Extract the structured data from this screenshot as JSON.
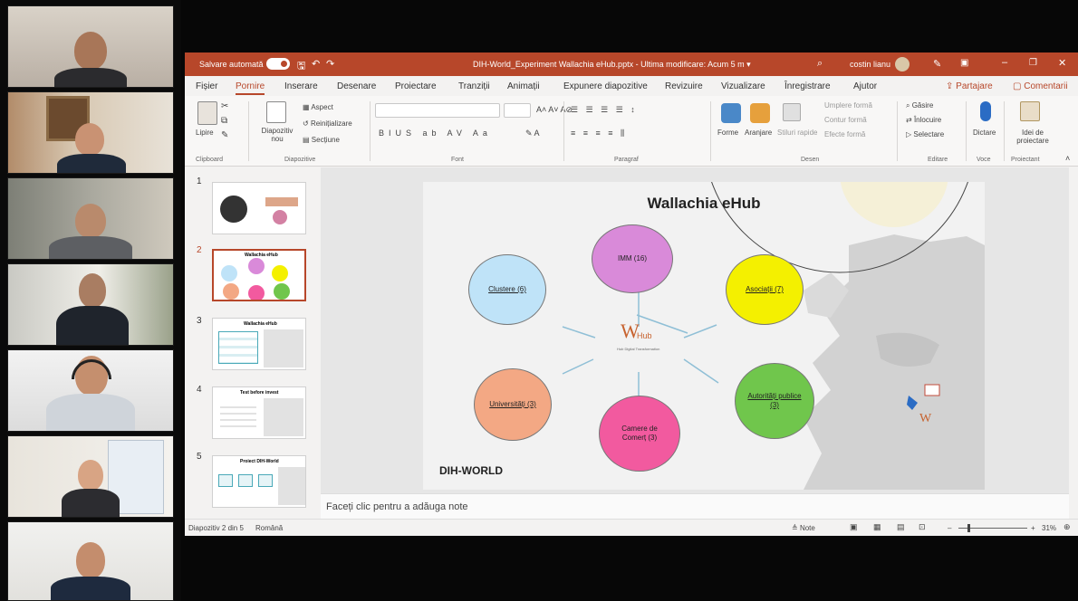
{
  "titlebar": {
    "autosave": "Salvare automată",
    "filename": "DIH-World_Experiment Wallachia eHub.pptx  -  Ultima modificare: Acum 5 m  ▾",
    "user": "costin lianu"
  },
  "tabs": [
    "Fișier",
    "Pornire",
    "Inserare",
    "Desenare",
    "Proiectare",
    "Tranziții",
    "Animații",
    "Expunere diapozitive",
    "Revizuire",
    "Vizualizare",
    "Înregistrare",
    "Ajutor"
  ],
  "share_btn": "Partajare",
  "comments_btn": "Comentarii",
  "ribbon": {
    "clipboard": {
      "paste": "Lipire",
      "group": "Clipboard"
    },
    "slides": {
      "new_slide": "Diapozitiv nou",
      "aspect": "Aspect",
      "reset": "Reinițializare",
      "section": "Secțiune",
      "group": "Diapozitive"
    },
    "font": {
      "group": "Font"
    },
    "paragraph": {
      "group": "Paragraf"
    },
    "drawing": {
      "shapes": "Forme",
      "arrange": "Aranjare",
      "quick_styles": "Stiluri rapide",
      "fill": "Umplere formă",
      "outline": "Contur formă",
      "effects": "Efecte formă",
      "group": "Desen"
    },
    "editing": {
      "find": "Găsire",
      "replace": "Înlocuire",
      "select": "Selectare",
      "group": "Editare"
    },
    "voice": {
      "dictate": "Dictare",
      "group": "Voce"
    },
    "designer": {
      "ideas": "Idei de proiectare",
      "group": "Proiectant"
    }
  },
  "thumbnails": [
    {
      "num": "1"
    },
    {
      "num": "2",
      "title": "Wallachia eHub"
    },
    {
      "num": "3",
      "title": "Wallachia eHub"
    },
    {
      "num": "4",
      "title": "Test before invest"
    },
    {
      "num": "5",
      "title": "Proiect DIH-World"
    }
  ],
  "slide": {
    "title": "Wallachia eHub",
    "nodes": [
      {
        "label": "IMM (16)",
        "color": "#d98ad9"
      },
      {
        "label": "Clustere (6)",
        "color": "#bfe3f8"
      },
      {
        "label": "Asociații (7)",
        "color": "#f4f000"
      },
      {
        "label": "Universități (3)",
        "color": "#f3a884"
      },
      {
        "label": "Camere de Comerț (3)",
        "color": "#f25a9f"
      },
      {
        "label": "Autorități publice (3)",
        "color": "#70c64c"
      }
    ],
    "logo_sub": "Hub Digital Transformation",
    "footer_logo": "DIH-WORLD"
  },
  "notes": "Faceți clic pentru a adăuga note",
  "status": {
    "slide": "Diapozitiv 2 din 5",
    "lang": "Română",
    "notes": "Note",
    "zoom": "31%"
  }
}
